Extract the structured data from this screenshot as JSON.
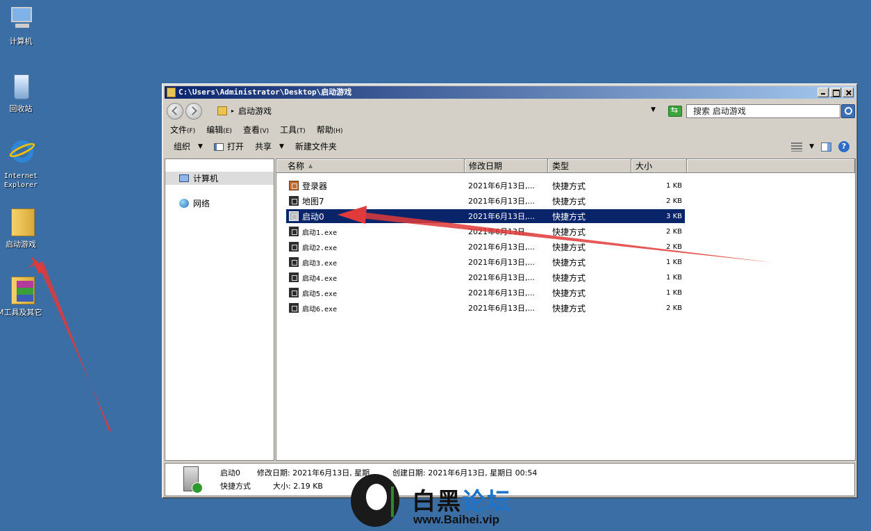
{
  "desktop": {
    "icons": [
      {
        "label": "计算机"
      },
      {
        "label": "回收站"
      },
      {
        "label": "Internet\nExplorer"
      },
      {
        "label": "启动游戏"
      },
      {
        "label": "M工具及其它"
      }
    ]
  },
  "window": {
    "title": "C:\\Users\\Administrator\\Desktop\\启动游戏",
    "address": "启动游戏",
    "search_placeholder": "搜索 启动游戏",
    "menu": [
      {
        "label": "文件",
        "hotkey": "(F)"
      },
      {
        "label": "编辑",
        "hotkey": "(E)"
      },
      {
        "label": "查看",
        "hotkey": "(V)"
      },
      {
        "label": "工具",
        "hotkey": "(T)"
      },
      {
        "label": "帮助",
        "hotkey": "(H)"
      }
    ],
    "toolbar": {
      "organize": "组织",
      "open": "打开",
      "share": "共享",
      "new_folder": "新建文件夹"
    },
    "nav": {
      "items": [
        {
          "label": "计算机",
          "selected": true
        },
        {
          "label": "网络",
          "selected": false
        }
      ]
    },
    "columns": [
      "名称",
      "修改日期",
      "类型",
      "大小"
    ],
    "files": [
      {
        "name": "登录器",
        "date": "2021年6月13日,...",
        "type": "快捷方式",
        "size": "1 KB"
      },
      {
        "name": "地图7",
        "date": "2021年6月13日,...",
        "type": "快捷方式",
        "size": "2 KB"
      },
      {
        "name": "启动0",
        "date": "2021年6月13日,...",
        "type": "快捷方式",
        "size": "3 KB"
      },
      {
        "name": "启动1.exe",
        "date": "2021年6月13日,...",
        "type": "快捷方式",
        "size": "2 KB"
      },
      {
        "name": "启动2.exe",
        "date": "2021年6月13日,...",
        "type": "快捷方式",
        "size": "2 KB"
      },
      {
        "name": "启动3.exe",
        "date": "2021年6月13日,...",
        "type": "快捷方式",
        "size": "1 KB"
      },
      {
        "name": "启动4.exe",
        "date": "2021年6月13日,...",
        "type": "快捷方式",
        "size": "1 KB"
      },
      {
        "name": "启动5.exe",
        "date": "2021年6月13日,...",
        "type": "快捷方式",
        "size": "1 KB"
      },
      {
        "name": "启动6.exe",
        "date": "2021年6月13日,...",
        "type": "快捷方式",
        "size": "2 KB"
      }
    ],
    "selected_index": 2,
    "details": {
      "name": "启动0",
      "modified": "修改日期: 2021年6月13日, 星期...",
      "created": "创建日期: 2021年6月13日, 星期日 00:54",
      "type": "快捷方式",
      "size": "大小: 2.19 KB"
    }
  },
  "watermark": {
    "title_part1": "白黑",
    "title_part2": "论坛",
    "url": "www.Baihei.vip"
  },
  "colors": {
    "desktop": "#3a6ea5",
    "selection": "#0a246a",
    "arrow": "#e03a3a"
  }
}
